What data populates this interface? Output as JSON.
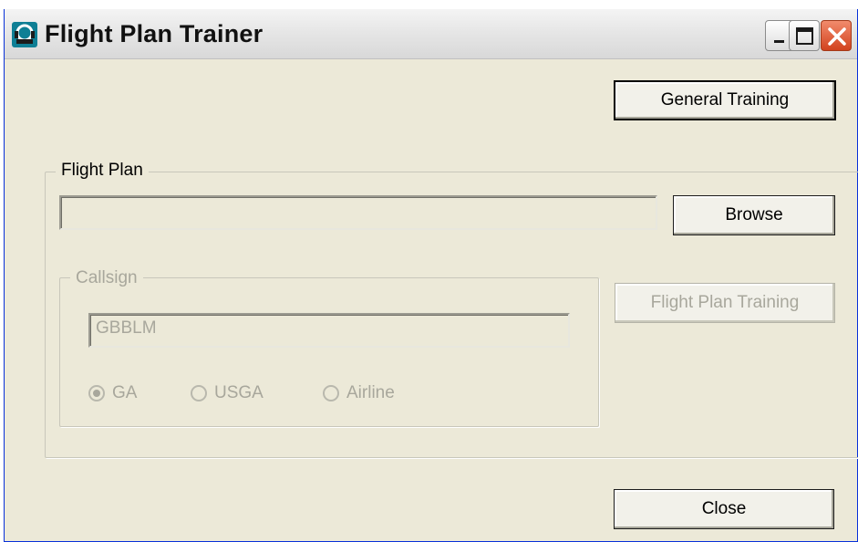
{
  "window": {
    "title": "Flight Plan Trainer",
    "controls": {
      "minimize": "minimize-icon",
      "maximize": "maximize-icon",
      "close": "close-icon"
    }
  },
  "buttons": {
    "general_training": "General Training",
    "browse": "Browse",
    "flight_plan_training": "Flight Plan Training",
    "close": "Close"
  },
  "flight_plan": {
    "group_label": "Flight Plan",
    "file_path_value": ""
  },
  "callsign": {
    "group_label": "Callsign",
    "value": "GBBLM",
    "options": [
      {
        "label": "GA",
        "selected": true
      },
      {
        "label": "USGA",
        "selected": false
      },
      {
        "label": "Airline",
        "selected": false
      }
    ]
  },
  "state": {
    "flight_plan_training_enabled": false,
    "callsign_enabled": false
  }
}
